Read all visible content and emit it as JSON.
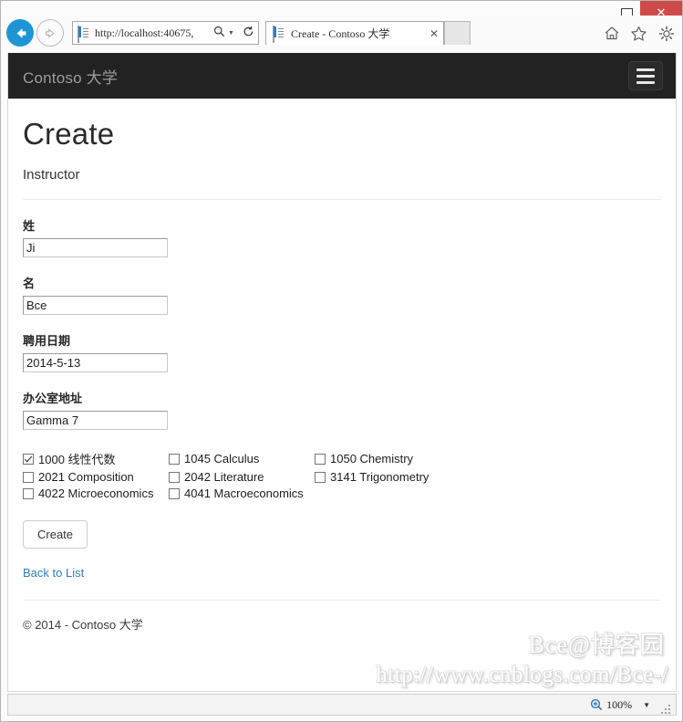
{
  "browser": {
    "window_controls": {
      "minimize": "—",
      "maximize": "□",
      "close": "✕"
    },
    "nav": {
      "back_label": "←",
      "forward_label": "→"
    },
    "address": {
      "url": "http://localhost:40675,",
      "search_icon": "⌕",
      "dropdown_caret": "▼",
      "refresh_icon": "↻"
    },
    "tab": {
      "title": "Create - Contoso 大学",
      "close_label": "✕"
    },
    "toolbar_icons": [
      {
        "name": "home-icon",
        "glyph": "⌂"
      },
      {
        "name": "favorites-star-icon",
        "glyph": "☆"
      },
      {
        "name": "settings-gear-icon",
        "glyph": "⚙"
      }
    ],
    "status": {
      "zoom_level": "100%",
      "zoom_caret": "▼"
    }
  },
  "page": {
    "navbar": {
      "brand": "Contoso 大学"
    },
    "title": "Create",
    "subtitle": "Instructor",
    "form": {
      "fields": [
        {
          "label": "姓",
          "value": "Ji",
          "name": "last-name"
        },
        {
          "label": "名",
          "value": "Bce",
          "name": "first-name"
        },
        {
          "label": "聘用日期",
          "value": "2014-5-13",
          "name": "hire-date"
        },
        {
          "label": "办公室地址",
          "value": "Gamma 7",
          "name": "office-address"
        }
      ],
      "courses": [
        {
          "label": "1000 线性代数",
          "checked": true
        },
        {
          "label": "1045 Calculus",
          "checked": false
        },
        {
          "label": "1050 Chemistry",
          "checked": false
        },
        {
          "label": "2021 Composition",
          "checked": false
        },
        {
          "label": "2042 Literature",
          "checked": false
        },
        {
          "label": "3141 Trigonometry",
          "checked": false
        },
        {
          "label": "4022 Microeconomics",
          "checked": false
        },
        {
          "label": "4041 Macroeconomics",
          "checked": false
        }
      ],
      "submit_label": "Create",
      "back_link": "Back to List"
    },
    "footer": "© 2014 - Contoso 大学",
    "watermark": {
      "line1": "Bce@博客园",
      "line2": "http://www.cnblogs.com/Bce-/"
    }
  },
  "colors": {
    "navbar_bg": "#222222",
    "brand_text": "#9d9d9d",
    "link": "#337ab7",
    "close_button": "#cf4a4a",
    "back_button": "#1f95d4"
  }
}
